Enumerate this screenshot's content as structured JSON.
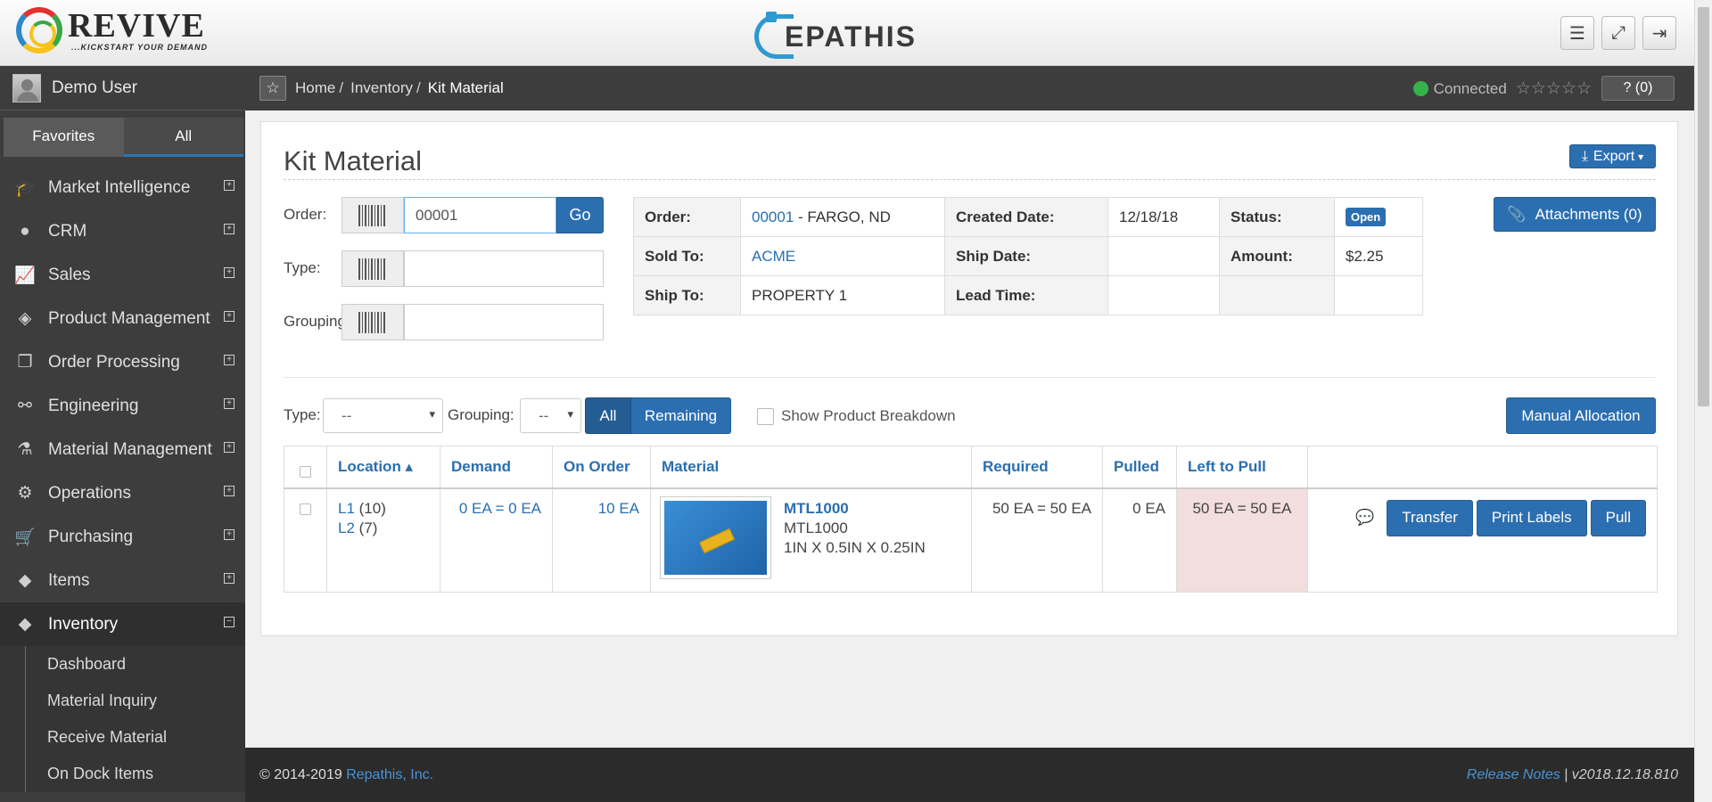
{
  "header": {
    "brand_left": "REVIVE",
    "brand_left_tag": "...KICKSTART YOUR DEMAND",
    "brand_center": "EPATHIS"
  },
  "sidebar": {
    "user_name": "Demo User",
    "tabs": [
      "Favorites",
      "All"
    ],
    "items": [
      {
        "label": "Market Intelligence",
        "icon": "graduation-cap-icon"
      },
      {
        "label": "CRM",
        "icon": "user-icon"
      },
      {
        "label": "Sales",
        "icon": "line-chart-icon"
      },
      {
        "label": "Product Management",
        "icon": "cube-icon"
      },
      {
        "label": "Order Processing",
        "icon": "files-icon"
      },
      {
        "label": "Engineering",
        "icon": "link-icon"
      },
      {
        "label": "Material Management",
        "icon": "flask-icon"
      },
      {
        "label": "Operations",
        "icon": "gears-icon"
      },
      {
        "label": "Purchasing",
        "icon": "cart-icon"
      },
      {
        "label": "Items",
        "icon": "cubes-icon"
      },
      {
        "label": "Inventory",
        "icon": "cubes-icon"
      }
    ],
    "sub_items": [
      "Dashboard",
      "Material Inquiry",
      "Receive Material",
      "On Dock Items"
    ]
  },
  "breadcrumb": {
    "items": [
      "Home",
      "Inventory",
      "Kit Material"
    ],
    "status": "Connected",
    "stars": "☆☆☆☆☆",
    "help": "? (0)"
  },
  "page": {
    "title": "Kit Material",
    "export_label": "Export",
    "attachments_label": "Attachments (0)",
    "form": {
      "order_label": "Order:",
      "order_value": "00001",
      "go_label": "Go",
      "type_label": "Type:",
      "grouping_label": "Grouping:"
    },
    "info": {
      "order_label": "Order:",
      "order_link": "00001",
      "order_rest": " - FARGO, ND",
      "created_label": "Created Date:",
      "created_value": "12/18/18",
      "status_label": "Status:",
      "status_value": "Open",
      "sold_to_label": "Sold To:",
      "sold_to_value": "ACME",
      "ship_date_label": "Ship Date:",
      "ship_date_value": "",
      "amount_label": "Amount:",
      "amount_value": "$2.25",
      "ship_to_label": "Ship To:",
      "ship_to_value": "PROPERTY 1",
      "lead_time_label": "Lead Time:",
      "lead_time_value": ""
    },
    "filters": {
      "type_label": "Type:",
      "type_value": "--",
      "grouping_label": "Grouping:",
      "grouping_value": "--",
      "all_label": "All",
      "remaining_label": "Remaining",
      "breakdown_label": "Show Product Breakdown",
      "manual_label": "Manual Allocation"
    },
    "table": {
      "headers": [
        "Location ▴",
        "Demand",
        "On Order",
        "Material",
        "Required",
        "Pulled",
        "Left to Pull"
      ],
      "row": {
        "loc1": "L1",
        "loc1_qty": " (10)",
        "loc2": "L2",
        "loc2_qty": " (7)",
        "demand": "0 EA = 0 EA",
        "on_order": "10 EA",
        "mat_code": "MTL1000",
        "mat_name": "MTL1000",
        "mat_desc": "1IN X 0.5IN X 0.25IN",
        "required": "50 EA = 50 EA",
        "pulled": "0 EA",
        "left": "50 EA = 50 EA",
        "transfer": "Transfer",
        "print": "Print Labels",
        "pull": "Pull"
      }
    }
  },
  "footer": {
    "copy": "© 2014-2019 ",
    "company": "Repathis, Inc.",
    "release": "Release Notes",
    "version": " | v2018.12.18.810"
  }
}
